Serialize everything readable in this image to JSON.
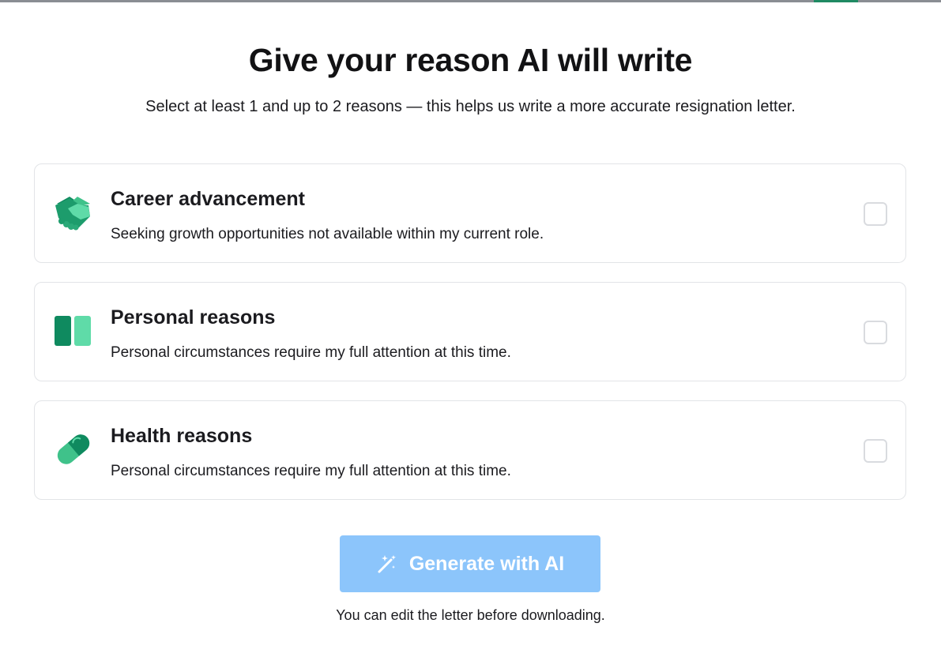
{
  "modal": {
    "title": "Give your reason AI will write",
    "subtitle": "Select at least 1 and up to 2 reasons — this helps us write a more accurate resignation letter."
  },
  "reasons": [
    {
      "icon": "handshake-icon",
      "title": "Career advancement",
      "description": "Seeking growth opportunities not available within my current role.",
      "checked": false
    },
    {
      "icon": "two-bars-icon",
      "title": "Personal reasons",
      "description": "Personal circumstances require my full attention at this time.",
      "checked": false
    },
    {
      "icon": "pill-capsule-icon",
      "title": "Health reasons",
      "description": "Personal circumstances require my full attention at this time.",
      "checked": false
    }
  ],
  "generate": {
    "label": "Generate with AI",
    "icon": "magic-wand-icon",
    "enabled": false
  },
  "footnote": "You can edit the letter before downloading.",
  "colors": {
    "accent_green_dark": "#0f8a5f",
    "accent_green_light": "#5fdba8",
    "button_disabled": "#8cc5fb"
  }
}
